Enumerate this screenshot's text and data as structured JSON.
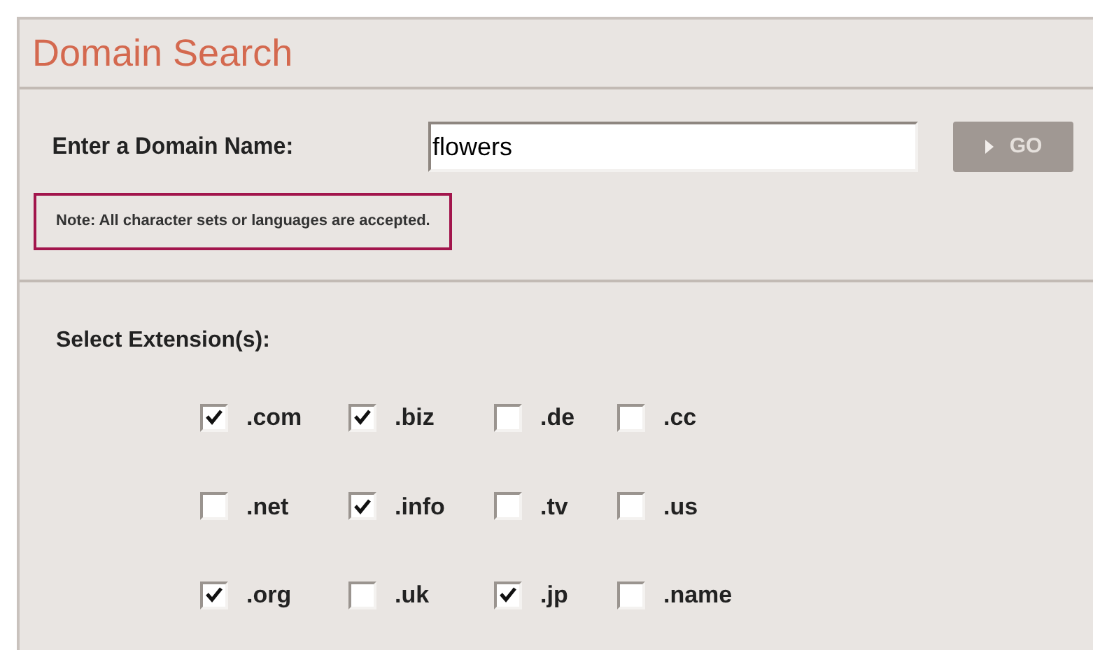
{
  "title": "Domain Search",
  "search": {
    "label": "Enter a Domain Name:",
    "value": "flowers",
    "button": "GO"
  },
  "note": "Note: All character sets or languages are accepted.",
  "extensions": {
    "label": "Select Extension(s):",
    "items": [
      {
        "label": ".com",
        "checked": true
      },
      {
        "label": ".biz",
        "checked": true
      },
      {
        "label": ".de",
        "checked": false
      },
      {
        "label": ".cc",
        "checked": false
      },
      {
        "label": ".net",
        "checked": false
      },
      {
        "label": ".info",
        "checked": true
      },
      {
        "label": ".tv",
        "checked": false
      },
      {
        "label": ".us",
        "checked": false
      },
      {
        "label": ".org",
        "checked": true
      },
      {
        "label": ".uk",
        "checked": false
      },
      {
        "label": ".jp",
        "checked": true
      },
      {
        "label": ".name",
        "checked": false
      }
    ]
  }
}
